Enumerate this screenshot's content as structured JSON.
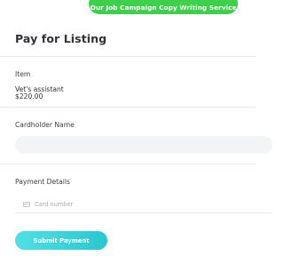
{
  "banner": {
    "label": "Our Job Campaign Copy Writing Service",
    "color": "#3ecf4b"
  },
  "page": {
    "title": "Pay for Listing"
  },
  "item": {
    "label": "Item",
    "name": "Vet's assistant",
    "price": "$220.00"
  },
  "cardholder": {
    "label": "Cardholder Name",
    "value": ""
  },
  "payment": {
    "label": "Payment Details",
    "card_placeholder": "Card number",
    "card_icon": "credit-card-icon"
  },
  "submit": {
    "label": "Submit Payment",
    "color": "#2fd0d6"
  }
}
